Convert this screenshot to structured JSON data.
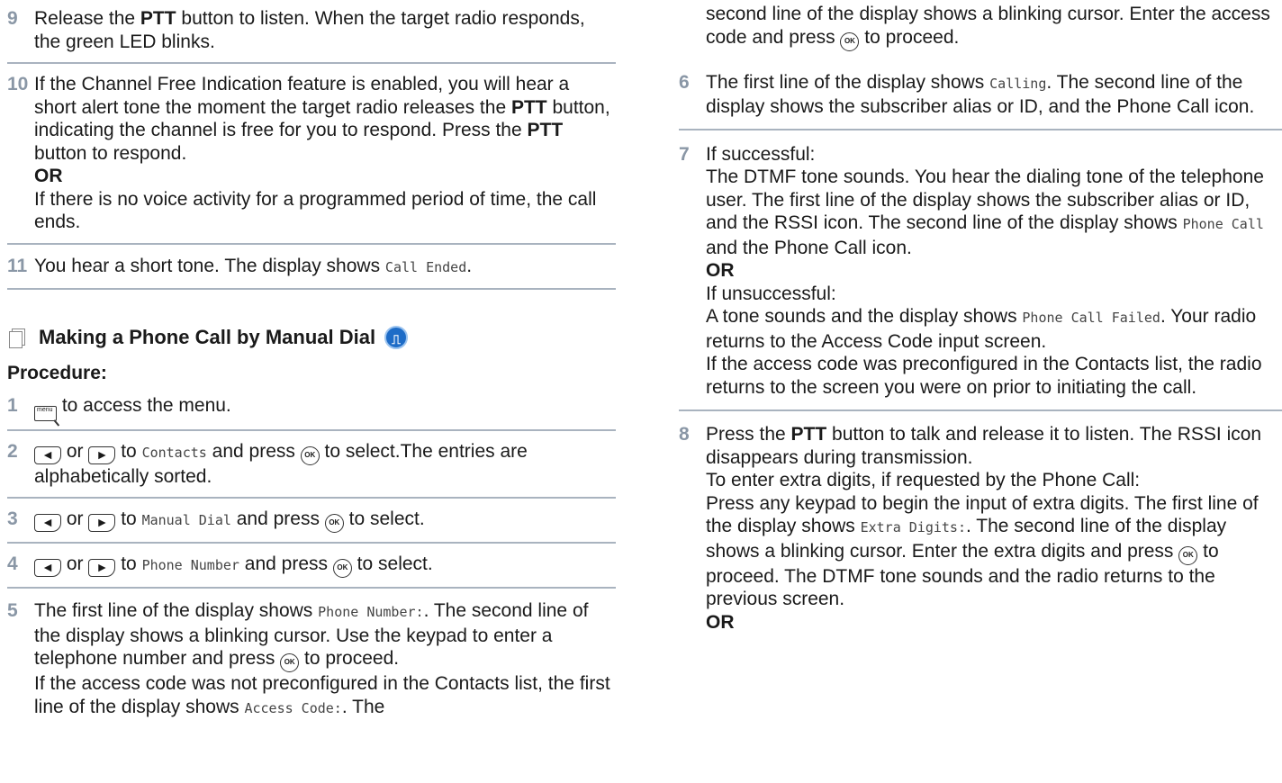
{
  "left": {
    "step9": {
      "num": "9",
      "pre": "Release the ",
      "ptt": "PTT",
      "post": " button to listen. When the target radio responds, the green LED blinks."
    },
    "step10": {
      "num": "10",
      "l1_pre": "If the Channel Free Indication feature is enabled, you will hear a short alert tone the moment the target radio releases the ",
      "ptt1": "PTT",
      "l1_mid": " button, indicating the channel is free for you to respond. Press the ",
      "ptt2": "PTT",
      "l1_post": " button to respond.",
      "or": "OR",
      "l2": "If there is no voice activity for a programmed period of time, the call ends."
    },
    "step11": {
      "num": "11",
      "pre": "You hear a short tone. The display shows ",
      "mono": "Call Ended",
      "post": "."
    },
    "section_title": "Making a Phone Call by Manual Dial",
    "procedure": "Procedure:",
    "step1": {
      "num": "1",
      "menu_key": "menu",
      "text": " to access the menu."
    },
    "step2": {
      "num": "2",
      "or": "or",
      "to": " to ",
      "mono": "Contacts",
      "mid": " and press ",
      "post": " to select.The entries are alphabetically sorted."
    },
    "step3": {
      "num": "3",
      "or": "or",
      "to": " to ",
      "mono": "Manual Dial",
      "mid": " and press ",
      "post": " to select."
    },
    "step4": {
      "num": "4",
      "or": "or",
      "to": " to ",
      "mono": "Phone Number",
      "mid": " and press ",
      "post": " to select."
    },
    "step5": {
      "num": "5",
      "a": "The first line of the display shows ",
      "mono1": "Phone Number:",
      "b": ". The second line of the display shows a blinking cursor. Use the keypad to enter a telephone number and press ",
      "c": " to proceed.",
      "d": "If the access code was not preconfigured in the Contacts list, the first line of the display shows ",
      "mono2": "Access Code:",
      "e": ". The"
    }
  },
  "right": {
    "cont5": {
      "a": "second line of the display shows a blinking cursor. Enter the access code and press ",
      "b": " to proceed."
    },
    "step6": {
      "num": "6",
      "a": "The first line of the display shows ",
      "mono": "Calling",
      "b": ". The second line of the display shows the subscriber alias or ID, and the Phone Call icon."
    },
    "step7": {
      "num": "7",
      "success": "If successful:",
      "s_a": "The DTMF tone sounds. You hear the dialing tone of the telephone user. The first line of the display shows the subscriber alias or ID, and the RSSI icon. The second line of the display shows ",
      "s_mono": "Phone Call",
      "s_b": " and the Phone Call icon.",
      "or": "OR",
      "fail": "If unsuccessful:",
      "f_a": "A tone sounds and the display shows ",
      "f_mono": "Phone Call Failed",
      "f_b": ". Your radio returns to the Access Code input screen.",
      "f_c": "If the access code was preconfigured in the Contacts list, the radio returns to the screen you were on prior to initiating the call."
    },
    "step8": {
      "num": "8",
      "a": "Press the ",
      "ptt": "PTT",
      "b": " button to talk and release it to listen. The RSSI icon disappears during transmission.",
      "c": "To enter extra digits, if requested by the Phone Call:",
      "d": "Press any keypad to begin the input of extra digits. The first line of the display shows ",
      "mono": "Extra Digits:",
      "e": ". The second line of the display shows a blinking cursor. Enter the extra digits and press ",
      "f": " to proceed. The DTMF tone sounds and the radio returns to the previous screen.",
      "or": "OR"
    }
  },
  "keys": {
    "ok": "OK",
    "left_arrow": "◄",
    "right_arrow": "►"
  },
  "colors": {
    "step_number": "#8a97a6",
    "separator": "#a9b3bf",
    "feature_icon": "#1e6cc7"
  }
}
